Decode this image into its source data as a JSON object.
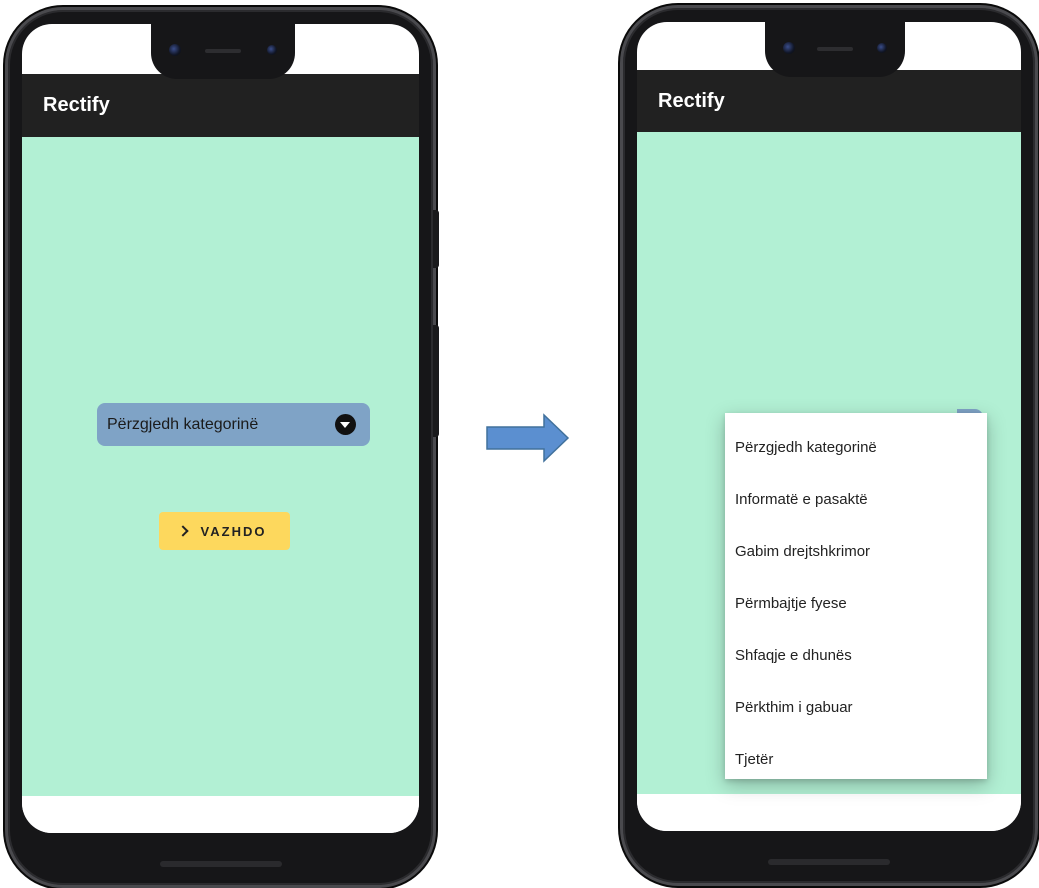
{
  "left_screen": {
    "app_title": "Rectify",
    "dropdown": {
      "selected": "Përzgjedh kategorinë"
    },
    "continue_button": {
      "label": "VAZHDO"
    }
  },
  "right_screen": {
    "app_title": "Rectify",
    "menu_items": [
      "Përzgjedh kategorinë",
      "Informatë e pasaktë",
      "Gabim drejtshkrimor",
      "Përmbajtje fyese",
      "Shfaqje e dhunës",
      "Përkthim i gabuar",
      "Tjetër"
    ]
  },
  "colors": {
    "app_bar": "#212121",
    "content_bg": "#b2f0d4",
    "dropdown_bg": "#7fa3c6",
    "button_bg": "#fdd85d",
    "arrow": "#5b8fd0"
  },
  "icons": {
    "dropdown_indicator": "chevron-down-circle-icon",
    "continue_button_icon": "chevron-right-icon",
    "transition_arrow": "arrow-right-icon"
  }
}
